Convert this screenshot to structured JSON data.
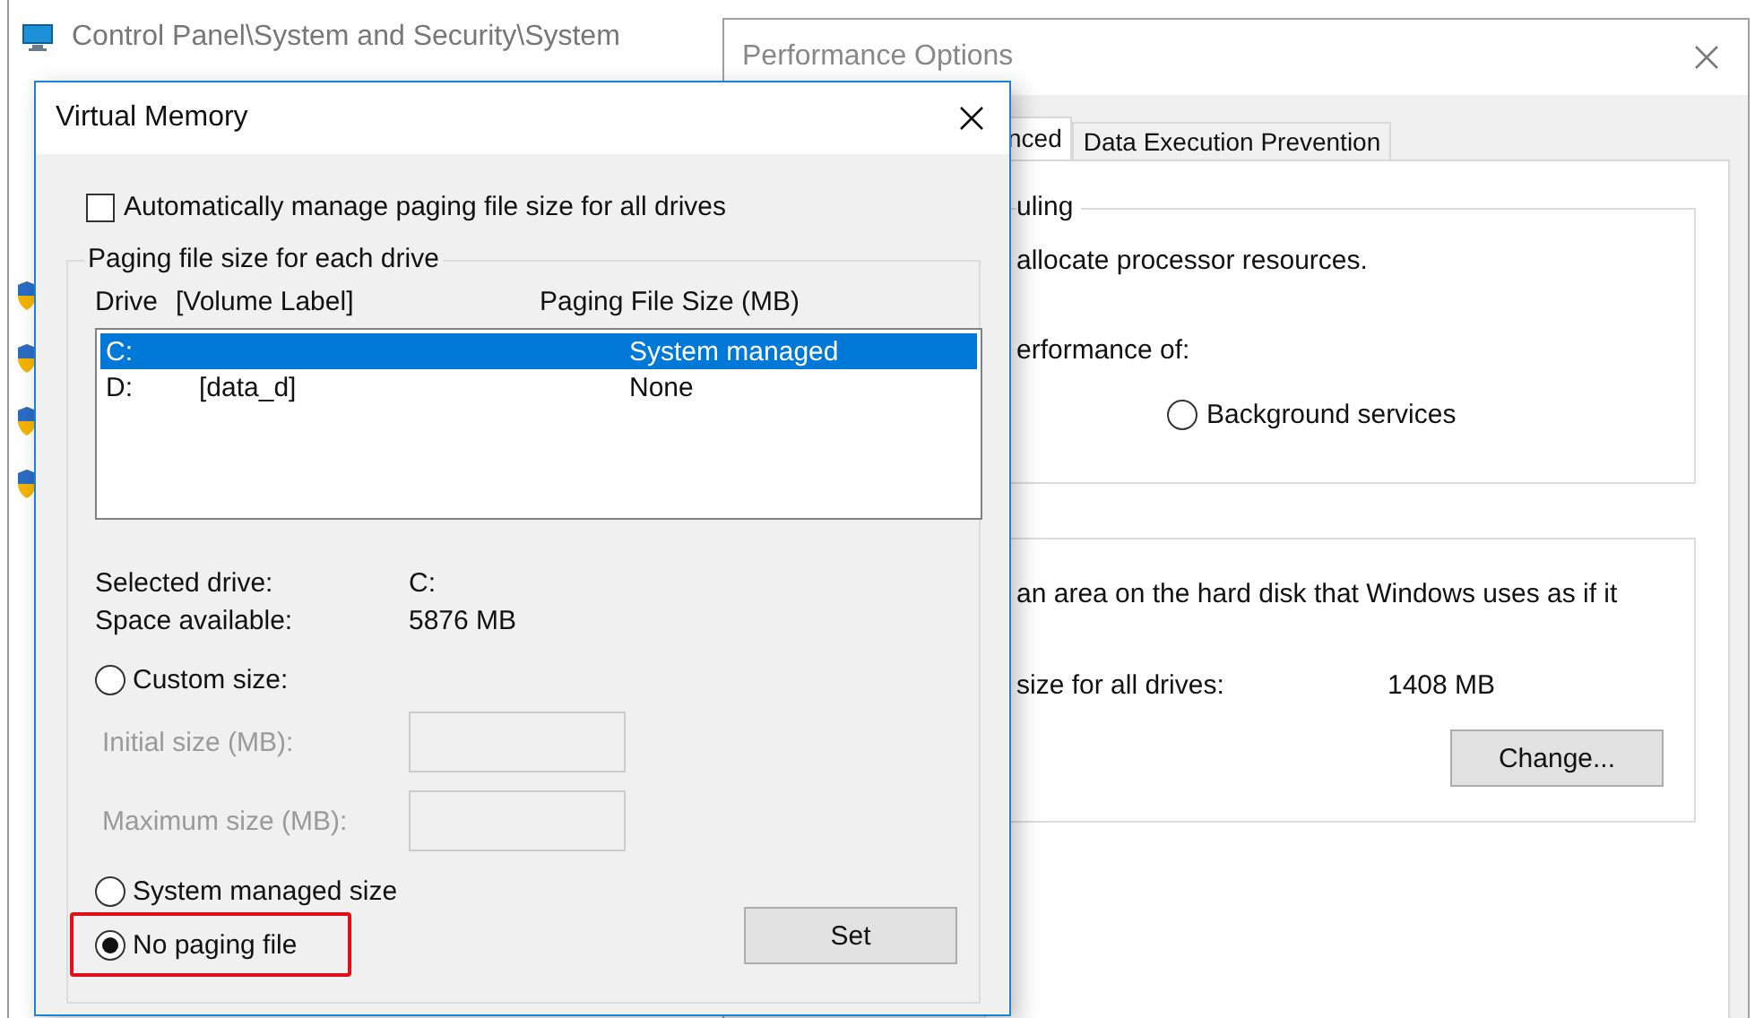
{
  "background_window": {
    "title": "Control Panel\\System and Security\\System"
  },
  "performance_options": {
    "title": "Performance Options",
    "tabs": [
      {
        "label": "nced",
        "selected": true
      },
      {
        "label": "Data Execution Prevention",
        "selected": false
      }
    ],
    "scheduling": {
      "title": "uling",
      "text": "allocate processor resources.",
      "adjust_label": "erformance of:",
      "options": [
        {
          "label": "Background services",
          "selected": false
        }
      ]
    },
    "virtual_memory": {
      "text": "an area on the hard disk that Windows uses as if it",
      "total_label": "size for all drives:",
      "total_value": "1408 MB",
      "button": "Change..."
    }
  },
  "dialog": {
    "title": "Virtual Memory",
    "auto_manage": {
      "label": "Automatically manage paging file size for all drives",
      "checked": false
    },
    "group_title": "Paging file size for each drive",
    "columns": [
      "Drive",
      "[Volume Label]",
      "Paging File Size (MB)"
    ],
    "drives": [
      {
        "drive": "C:",
        "size": "System managed",
        "selected": true
      },
      {
        "drive": "D:",
        "label": "[data_d]",
        "size": "None",
        "selected": false
      }
    ],
    "selected_drive": {
      "label": "Selected drive:",
      "value": "C:"
    },
    "space_available": {
      "label": "Space available:",
      "value": "5876 MB"
    },
    "options": [
      {
        "label": "Custom size:",
        "selected": false,
        "highlighted": false
      },
      {
        "label": "System managed size",
        "selected": false,
        "highlighted": false
      },
      {
        "label": "No paging file",
        "selected": true,
        "highlighted": true
      }
    ],
    "custom_fields": [
      {
        "label": "Initial size (MB):",
        "disabled": true
      },
      {
        "label": "Maximum size (MB):",
        "disabled": true
      }
    ],
    "set_button": "Set"
  }
}
